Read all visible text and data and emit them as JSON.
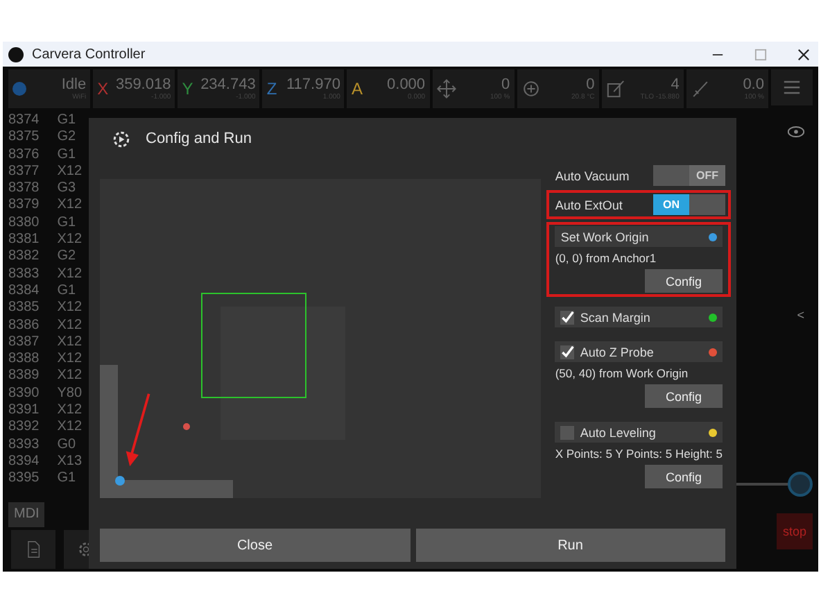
{
  "window": {
    "title": "Carvera Controller"
  },
  "status": [
    {
      "kind": "state",
      "value": "Idle",
      "sub": "WiFi"
    },
    {
      "kind": "axis",
      "letter": "X",
      "color": "#b03030",
      "value": "359.018",
      "sub": "-1.000"
    },
    {
      "kind": "axis",
      "letter": "Y",
      "color": "#2e8b3e",
      "value": "234.743",
      "sub": "-1.000"
    },
    {
      "kind": "axis",
      "letter": "Z",
      "color": "#2f6fb0",
      "value": "117.970",
      "sub": "1.000"
    },
    {
      "kind": "axis",
      "letter": "A",
      "color": "#b8902a",
      "value": "0.000",
      "sub": "0.000"
    },
    {
      "kind": "icon",
      "value": "0",
      "sub": "100 %"
    },
    {
      "kind": "icon",
      "value": "0",
      "sub": "20.8 °C"
    },
    {
      "kind": "icon",
      "value": "4",
      "sub": "TLO -15.880"
    },
    {
      "kind": "icon",
      "value": "0.0",
      "sub": "100 %"
    }
  ],
  "slider": {
    "level": 1
  },
  "code_lines": [
    {
      "number": "8374",
      "code": "G1"
    },
    {
      "number": "8375",
      "code": "G2"
    },
    {
      "number": "8376",
      "code": "G1"
    },
    {
      "number": "8377",
      "code": "X12"
    },
    {
      "number": "8378",
      "code": "G3"
    },
    {
      "number": "8379",
      "code": "X12"
    },
    {
      "number": "8380",
      "code": "G1"
    },
    {
      "number": "8381",
      "code": "X12"
    },
    {
      "number": "8382",
      "code": "G2"
    },
    {
      "number": "8383",
      "code": "X12"
    },
    {
      "number": "8384",
      "code": "G1"
    },
    {
      "number": "8385",
      "code": "X12"
    },
    {
      "number": "8386",
      "code": "X12"
    },
    {
      "number": "8387",
      "code": "X12"
    },
    {
      "number": "8388",
      "code": "X12"
    },
    {
      "number": "8389",
      "code": "X12"
    },
    {
      "number": "8390",
      "code": "Y80"
    },
    {
      "number": "8391",
      "code": "X12"
    },
    {
      "number": "8392",
      "code": "X12"
    },
    {
      "number": "8393",
      "code": "G0"
    },
    {
      "number": "8394",
      "code": "X13"
    },
    {
      "number": "8395",
      "code": "G1"
    }
  ],
  "mdi_button": "MDI",
  "stop_button": "stop",
  "side_tab": "<",
  "dialog": {
    "title": "Config and Run",
    "toggles": [
      {
        "label": "Auto Vacuum",
        "on": false,
        "state": "OFF",
        "highlighted": false
      },
      {
        "label": "Auto ExtOut",
        "on": true,
        "state": "ON",
        "highlighted": true
      }
    ],
    "sections": [
      {
        "kind": "plain",
        "title": "Set Work Origin",
        "color": "#3a9be0",
        "detail": "(0, 0) from Anchor1",
        "button": "Config",
        "highlighted": true
      },
      {
        "kind": "check",
        "title": "Scan Margin",
        "checked": true,
        "color": "#22c02a",
        "highlighted": false
      },
      {
        "kind": "check",
        "title": "Auto Z Probe",
        "checked": true,
        "color": "#e0503a",
        "detail": "(50, 40) from Work Origin",
        "button": "Config",
        "highlighted": false
      },
      {
        "kind": "check",
        "title": "Auto Leveling",
        "checked": false,
        "color": "#e8c830",
        "detail": "X Points: 5 Y Points: 5 Height: 5",
        "button": "Config",
        "highlighted": false
      }
    ],
    "buttons": [
      "Close",
      "Run"
    ]
  }
}
